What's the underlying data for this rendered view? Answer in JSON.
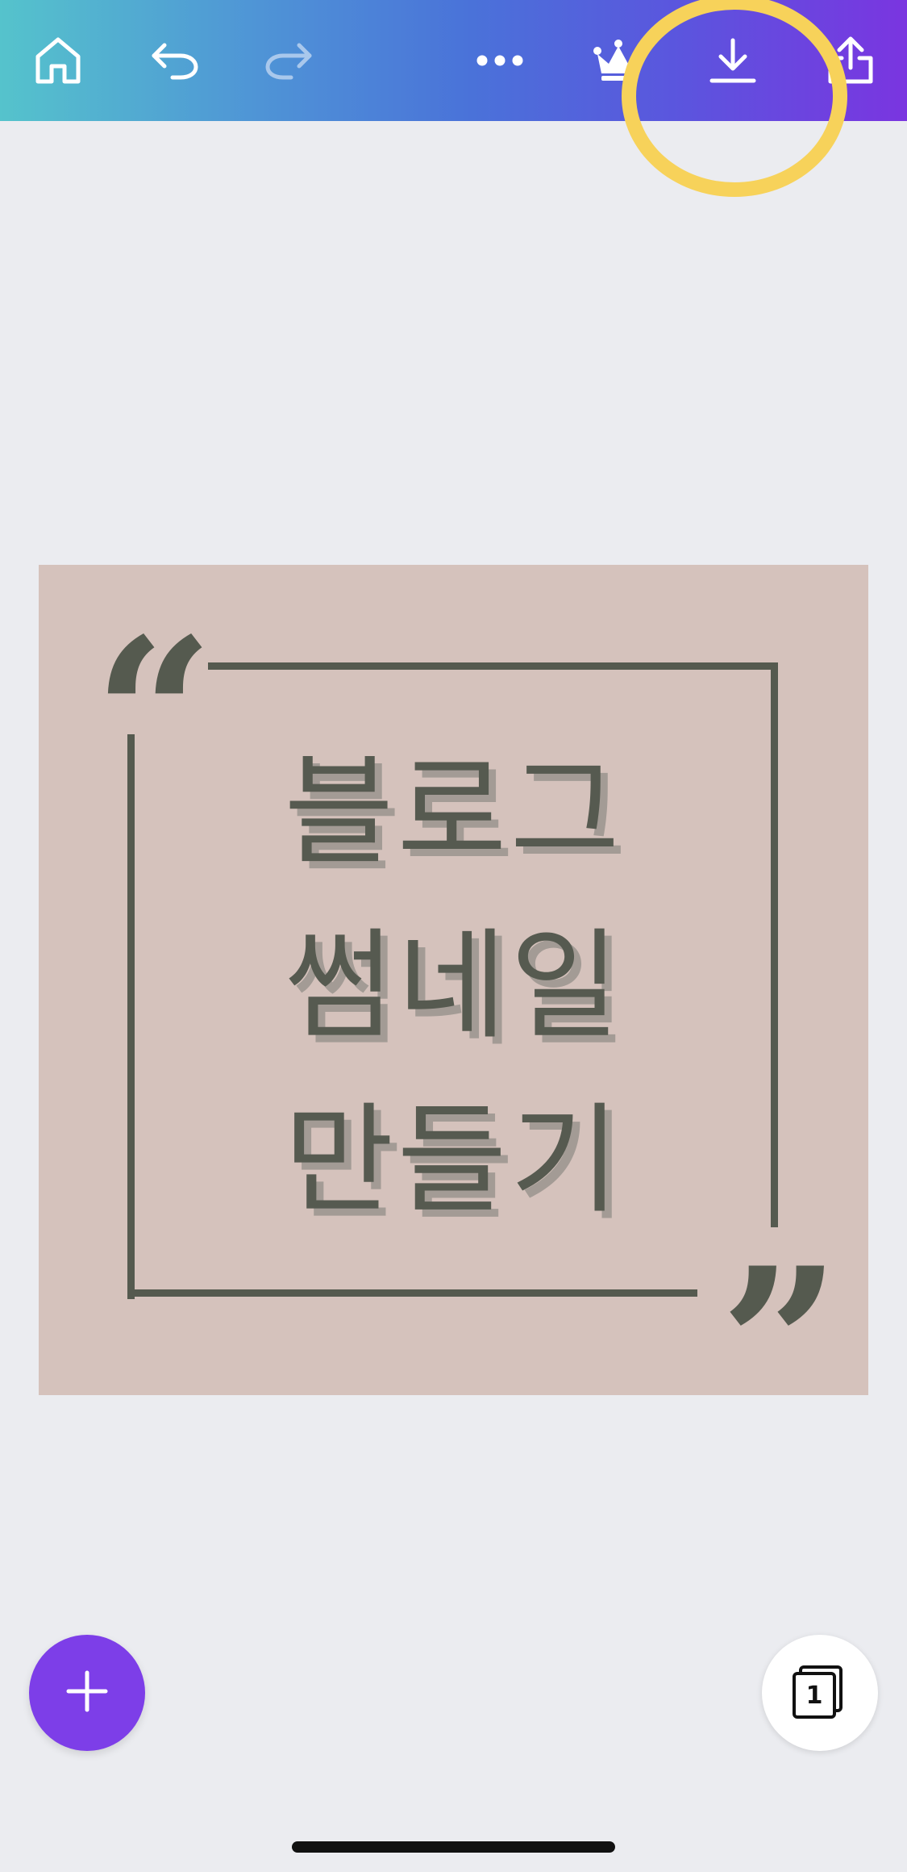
{
  "toolbar": {
    "icons": {
      "home": "home-icon",
      "undo": "undo-icon",
      "redo": "redo-icon",
      "more": "more-icon",
      "premium": "crown-icon",
      "download": "download-icon",
      "share": "share-icon"
    },
    "gradient": [
      "#55c3cc",
      "#4f95d6",
      "#5b55de",
      "#7a35e0"
    ]
  },
  "highlight": {
    "color": "#f7d25a",
    "target": "download-button"
  },
  "design": {
    "background": "#d5c2bc",
    "ink": "#555a4f",
    "open_quote": "“",
    "close_quote": "”",
    "title_lines": [
      "블로그",
      "썸네일",
      "만들기"
    ]
  },
  "fab": {
    "icon": "plus-icon",
    "color": "#7d3ee8"
  },
  "pages": {
    "count": "1"
  }
}
